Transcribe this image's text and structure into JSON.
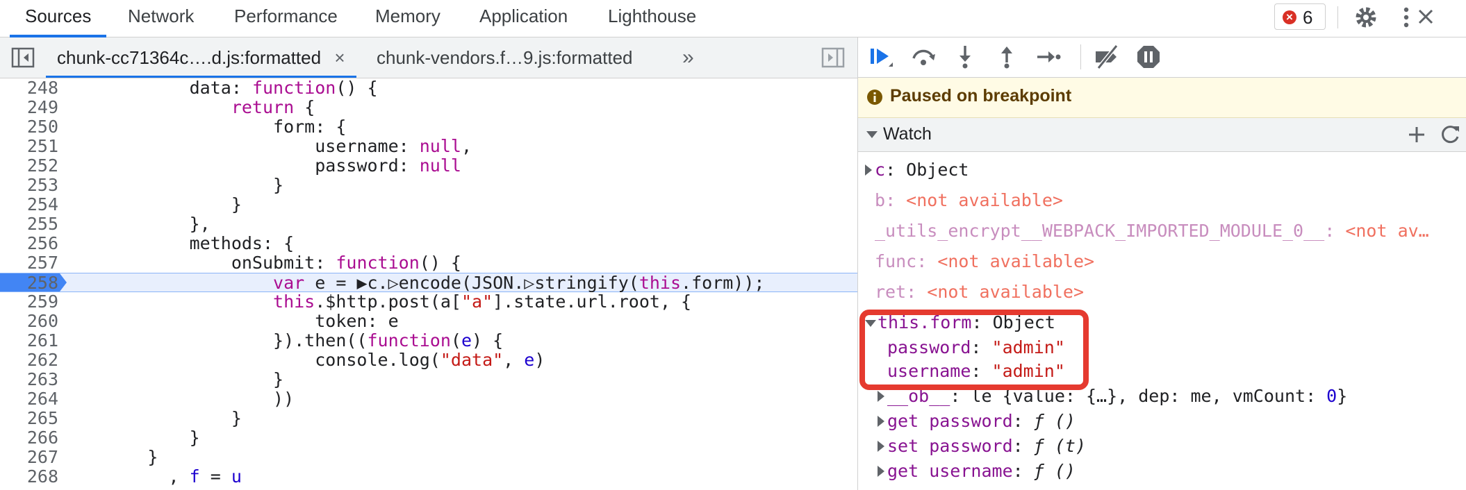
{
  "topTabs": [
    "Sources",
    "Network",
    "Performance",
    "Memory",
    "Application",
    "Lighthouse"
  ],
  "errorCount": "6",
  "fileTabs": [
    "chunk-cc71364c….d.js:formatted",
    "chunk-vendors.f…9.js:formatted"
  ],
  "code": {
    "lines": [
      {
        "n": "248",
        "html": "            data: <span class=\"kw\">function</span>() {"
      },
      {
        "n": "249",
        "html": "                <span class=\"kw\">return</span> {"
      },
      {
        "n": "250",
        "html": "                    form: {"
      },
      {
        "n": "251",
        "html": "                        username: <span class=\"kw\">null</span>,"
      },
      {
        "n": "252",
        "html": "                        password: <span class=\"kw\">null</span>"
      },
      {
        "n": "253",
        "html": "                    }"
      },
      {
        "n": "254",
        "html": "                }"
      },
      {
        "n": "255",
        "html": "            },"
      },
      {
        "n": "256",
        "html": "            methods: {"
      },
      {
        "n": "257",
        "html": "                onSubmit: <span class=\"kw\">function</span>() {"
      },
      {
        "n": "258",
        "html": "                    <span class=\"kw\">var</span> e = ▶c.▷encode(JSON.▷stringify(<span class=\"kw\">this</span>.form));"
      },
      {
        "n": "259",
        "html": "                    <span class=\"kw\">this</span>.$http.post(a[<span class=\"str\">\"a\"</span>].state.url.root, {"
      },
      {
        "n": "260",
        "html": "                        token: e"
      },
      {
        "n": "261",
        "html": "                    }).then((<span class=\"kw\">function</span>(<span class=\"var\">e</span>) {"
      },
      {
        "n": "262",
        "html": "                        console.log(<span class=\"str\">\"data\"</span>, <span class=\"var\">e</span>)"
      },
      {
        "n": "263",
        "html": "                    }"
      },
      {
        "n": "264",
        "html": "                    ))"
      },
      {
        "n": "265",
        "html": "                }"
      },
      {
        "n": "266",
        "html": "            }"
      },
      {
        "n": "267",
        "html": "        }"
      },
      {
        "n": "268",
        "html": "          , <span class=\"var\">f</span> = <span class=\"var\">u</span>"
      }
    ],
    "breakpoint_line": "258"
  },
  "debugger": {
    "paused_text": "Paused on breakpoint",
    "watch_title": "Watch",
    "watch": {
      "c_name": "c",
      "c_value": "Object",
      "b_name": "b",
      "not_available": "<not available>",
      "utils_name": "_utils_encrypt__WEBPACK_IMPORTED_MODULE_0__",
      "utils_value": "<not av…",
      "func_name": "func",
      "ret_name": "ret",
      "form_name": "this.form",
      "form_value": "Object",
      "password_name": "password",
      "password_value": "\"admin\"",
      "username_name": "username",
      "username_value": "\"admin\"",
      "ob_name": "__ob__",
      "ob_value_prefix": "le {value: {…}, dep: me, vmCount: ",
      "ob_count": "0",
      "ob_value_suffix": "}",
      "get_password": "get password",
      "set_password": "set password",
      "get_username": "get username",
      "f_empty": "ƒ ()",
      "f_t": "ƒ (t)"
    }
  },
  "colors": {
    "accent": "#1a73e8",
    "highlight_box": "#e53a2f",
    "paused_bg": "#fffbe5"
  }
}
